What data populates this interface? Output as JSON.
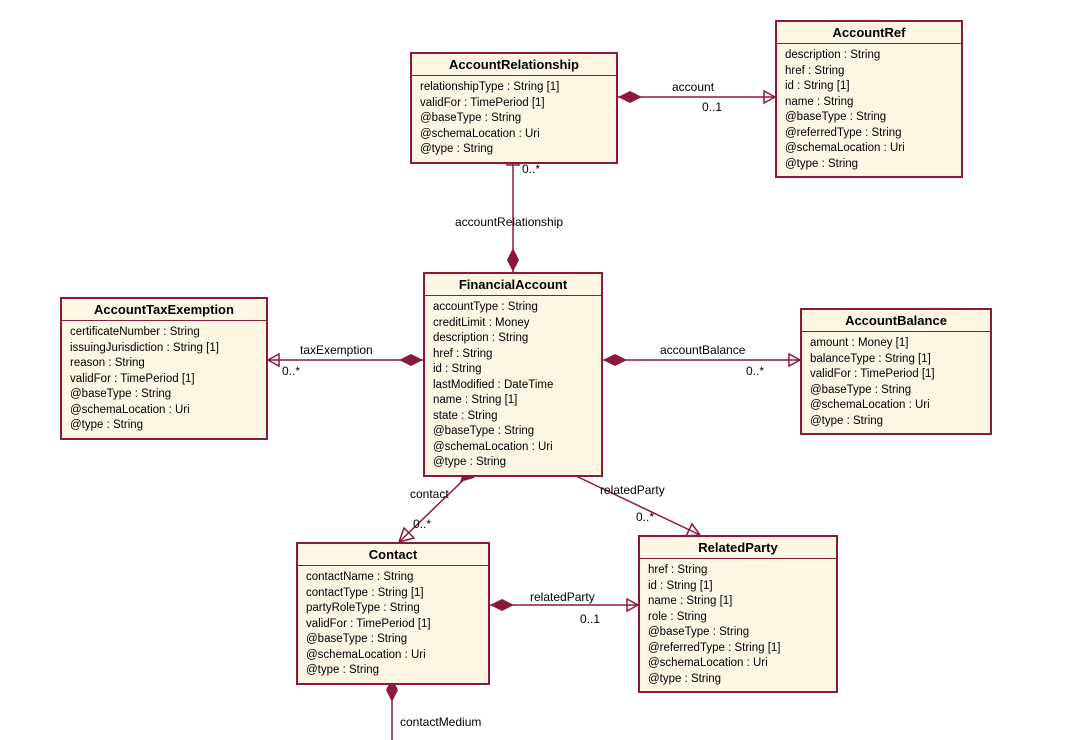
{
  "classes": {
    "accountRelationship": {
      "title": "AccountRelationship",
      "attrs": [
        "relationshipType : String [1]",
        "validFor : TimePeriod [1]",
        "@baseType : String",
        "@schemaLocation : Uri",
        "@type : String"
      ]
    },
    "accountRef": {
      "title": "AccountRef",
      "attrs": [
        "description : String",
        "href : String",
        "id : String [1]",
        "name : String",
        "@baseType : String",
        "@referredType : String",
        "@schemaLocation : Uri",
        "@type : String"
      ]
    },
    "accountTaxExemption": {
      "title": "AccountTaxExemption",
      "attrs": [
        "certificateNumber : String",
        "issuingJurisdiction : String [1]",
        "reason : String",
        "validFor : TimePeriod [1]",
        "@baseType : String",
        "@schemaLocation : Uri",
        "@type : String"
      ]
    },
    "financialAccount": {
      "title": "FinancialAccount",
      "attrs": [
        "accountType : String",
        "creditLimit : Money",
        "description : String",
        "href : String",
        "id : String",
        "lastModified : DateTime",
        "name : String [1]",
        "state : String",
        "@baseType : String",
        "@schemaLocation : Uri",
        "@type : String"
      ]
    },
    "accountBalance": {
      "title": "AccountBalance",
      "attrs": [
        "amount : Money [1]",
        "balanceType : String [1]",
        "validFor : TimePeriod [1]",
        "@baseType : String",
        "@schemaLocation : Uri",
        "@type : String"
      ]
    },
    "contact": {
      "title": "Contact",
      "attrs": [
        "contactName : String",
        "contactType : String [1]",
        "partyRoleType : String",
        "validFor : TimePeriod [1]",
        "@baseType : String",
        "@schemaLocation : Uri",
        "@type : String"
      ]
    },
    "relatedParty": {
      "title": "RelatedParty",
      "attrs": [
        "href : String",
        "id : String [1]",
        "name : String [1]",
        "role : String",
        "@baseType : String",
        "@referredType : String [1]",
        "@schemaLocation : Uri",
        "@type : String"
      ]
    }
  },
  "associations": {
    "account": {
      "label": "account",
      "mult": "0..1"
    },
    "accountRelationship": {
      "label": "accountRelationship",
      "mult": "0..*"
    },
    "taxExemption": {
      "label": "taxExemption",
      "mult": "0..*"
    },
    "accountBalance": {
      "label": "accountBalance",
      "mult": "0..*"
    },
    "contact": {
      "label": "contact",
      "mult": "0..*"
    },
    "relatedPartyFA": {
      "label": "relatedParty",
      "mult": "0..*"
    },
    "relatedPartyContact": {
      "label": "relatedParty",
      "mult": "0..1"
    },
    "contactMedium": {
      "label": "contactMedium"
    }
  }
}
